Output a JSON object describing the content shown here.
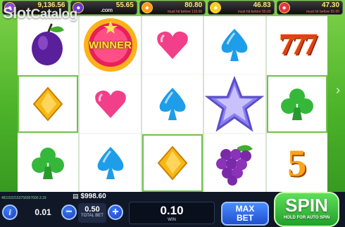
{
  "jackpots": [
    {
      "amount": "9,136.56",
      "must_hit": "",
      "icon": "grape-coin-icon",
      "color": "#8a4ad8"
    },
    {
      "amount": "55.65",
      "must_hit": "",
      "icon": "plum-coin-icon",
      "color": "#6a3ac8"
    },
    {
      "amount": "80.80",
      "must_hit": "must hit before 110.00",
      "icon": "orange-coin-icon",
      "color": "#ff9a1a"
    },
    {
      "amount": "46.83",
      "must_hit": "must hit before 55.00",
      "icon": "lemon-coin-icon",
      "color": "#f0d21a"
    },
    {
      "amount": "47.30",
      "must_hit": "must hit before 55.00",
      "icon": "strawberry-coin-icon",
      "color": "#e03a3a"
    }
  ],
  "watermark": {
    "main": "Slot",
    "sub": "Catalog",
    "suffix": ".com"
  },
  "reels": [
    [
      "plum",
      "diamond",
      "club"
    ],
    [
      "winner",
      "heart",
      "spade"
    ],
    [
      "heart",
      "spade",
      "diamond"
    ],
    [
      "spade",
      "star",
      "grape"
    ],
    [
      "seven",
      "club",
      "five"
    ]
  ],
  "wins": {
    "winner_label": "WINNER",
    "five_label": "5",
    "seven_label": "777"
  },
  "balance": {
    "label_icon": "wallet-icon",
    "value": "$998.60"
  },
  "hash": "4811532153756057600.3.19",
  "info_icon": "info-icon",
  "coin_value": "0.01",
  "bet": {
    "value": "0.50",
    "label": "TOTAL BET",
    "minus": "−",
    "plus": "+"
  },
  "win": {
    "value": "0.10",
    "label": "WIN"
  },
  "max_bet": {
    "line1": "MAX",
    "line2": "BET"
  },
  "spin": {
    "label": "SPIN",
    "sub": "HOLD FOR AUTO SPIN"
  },
  "side_arrow": "›"
}
